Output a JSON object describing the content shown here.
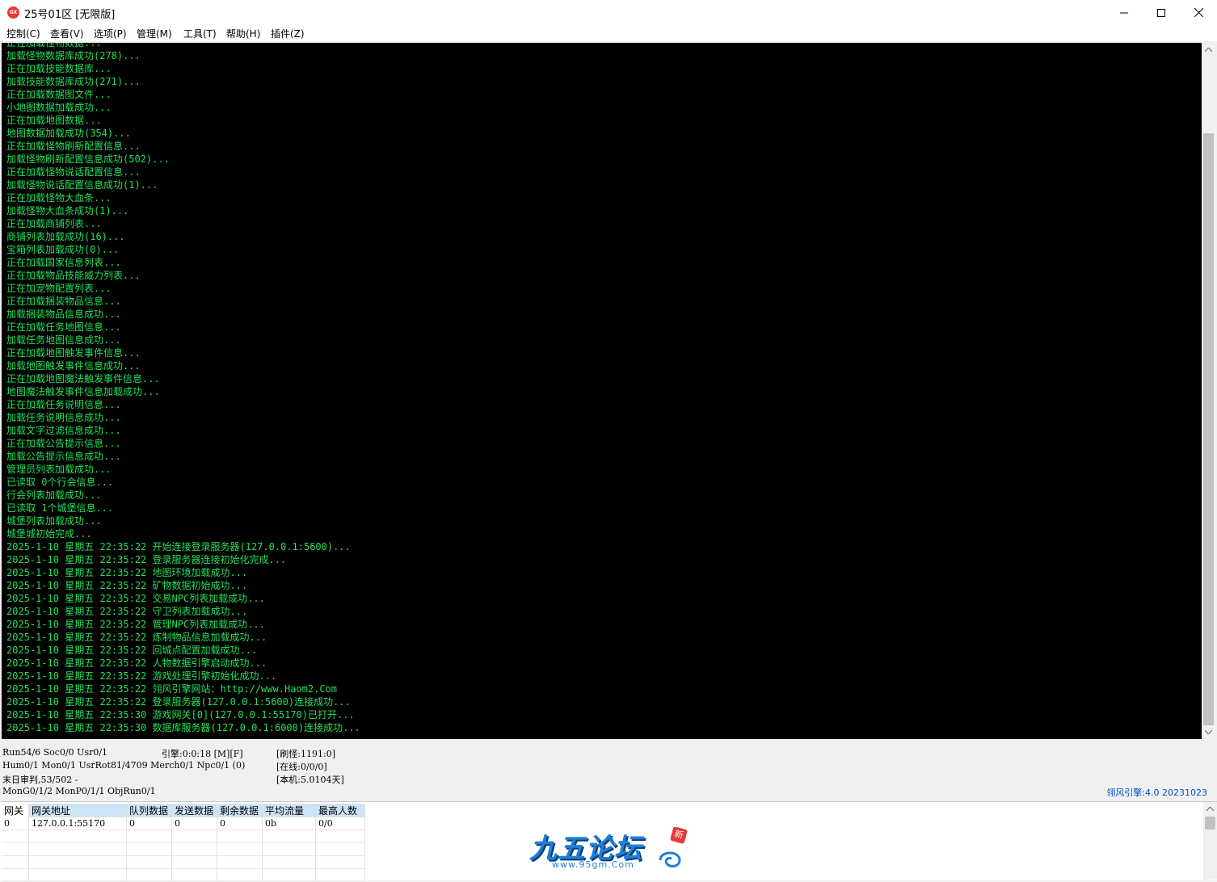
{
  "window": {
    "icon_text": "GX",
    "title": "25号01区 [无限版]"
  },
  "menu": [
    "控制(C)",
    "查看(V)",
    "选项(P)",
    "管理(M)",
    "工具(T)",
    "帮助(H)",
    "插件(Z)"
  ],
  "console": {
    "lines": [
      "正在加载怪物数据...",
      "加载怪物数据库成功(278)...",
      "正在加载技能数据库...",
      "加载技能数据库成功(271)...",
      "正在加载数据图文件...",
      "小地图数据加载成功...",
      "正在加载地图数据...",
      "地图数据加载成功(354)...",
      "正在加载怪物刷新配置信息...",
      "加载怪物刷新配置信息成功(502)...",
      "正在加载怪物说话配置信息...",
      "加载怪物说话配置信息成功(1)...",
      "正在加载怪物大血条...",
      "加载怪物大血条成功(1)...",
      "正在加载商铺列表...",
      "商铺列表加载成功(16)...",
      "宝箱列表加载成功(0)...",
      "正在加载国家信息列表...",
      "正在加载物品技能威力列表...",
      "正在加宠物配置列表...",
      "正在加载捆装物品信息...",
      "加载捆装物品信息成功...",
      "正在加载任务地图信息...",
      "加载任务地图信息成功...",
      "正在加载地图触发事件信息...",
      "加载地图触发事件信息成功...",
      "正在加载地图魔法触发事件信息...",
      "地图魔法触发事件信息加载成功...",
      "正在加载任务说明信息...",
      "加载任务说明信息成功...",
      "加载文字过滤信息成功...",
      "正在加载公告提示信息...",
      "加载公告提示信息成功...",
      "管理员列表加载成功...",
      "已读取 0个行会信息...",
      "行会列表加载成功...",
      "已读取 1个城堡信息...",
      "城堡列表加载成功...",
      "城堡城初始完成...",
      "2025-1-10 星期五 22:35:22 开始连接登录服务器(127.0.0.1:5600)...",
      "2025-1-10 星期五 22:35:22 登录服务器连接初始化完成...",
      "2025-1-10 星期五 22:35:22 地图环境加载成功...",
      "2025-1-10 星期五 22:35:22 矿物数据初始成功...",
      "2025-1-10 星期五 22:35:22 交易NPC列表加载成功...",
      "2025-1-10 星期五 22:35:22 守卫列表加载成功...",
      "2025-1-10 星期五 22:35:22 管理NPC列表加载成功...",
      "2025-1-10 星期五 22:35:22 炼制物品信息加载成功...",
      "2025-1-10 星期五 22:35:22 回城点配置加载成功...",
      "2025-1-10 星期五 22:35:22 人物数据引擎启动成功...",
      "2025-1-10 星期五 22:35:22 游戏处理引擎初始化成功...",
      "2025-1-10 星期五 22:35:22 翎风引擎网站：http://www.Haom2.Com",
      "2025-1-10 星期五 22:35:22 登录服务器(127.0.0.1:5600)连接成功...",
      "2025-1-10 星期五 22:35:30 游戏网关[0](127.0.0.1:55170)已打开...",
      "2025-1-10 星期五 22:35:30 数据库服务器(127.0.0.1:6000)连接成功..."
    ]
  },
  "status": {
    "run": "Run54/6 Soc0/0 Usr0/1",
    "engine_time": "引擎:0:0:18 [M][F]",
    "refresh": "[刷怪:1191:0]",
    "hum": "Hum0/1 Mon0/1 UsrRot81/4709 Merch0/1 Npc0/1 (0)",
    "online": "[在线:0/0/0]",
    "judge": "末日审判,53/502 -",
    "local": "[本机:5.0104天]",
    "mon": "MonG0/1/2 MonP0/1/1 ObjRun0/1",
    "version": "翎风引擎:4.0 20231023"
  },
  "gateway_table": {
    "headers": [
      "网关",
      "网关地址",
      "队列数据",
      "发送数据",
      "剩余数据",
      "平均流量",
      "最高人数"
    ],
    "rows": [
      [
        "0",
        "127.0.0.1:55170",
        "0",
        "0",
        "0",
        "0b",
        "0/0"
      ]
    ]
  },
  "watermark": {
    "title": "九五论坛",
    "url": "www.95gm.Com",
    "badge": "新"
  }
}
